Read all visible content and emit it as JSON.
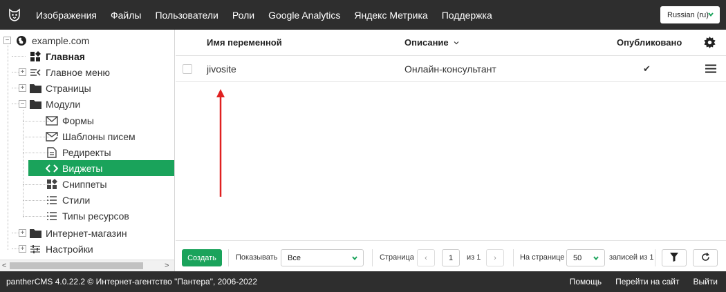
{
  "topbar": {
    "logo_icon": "panther-logo-icon",
    "nav": [
      "Изображения",
      "Файлы",
      "Пользователи",
      "Роли",
      "Google Analytics",
      "Яндекс Метрика",
      "Поддержка"
    ],
    "language": "Russian (ru)"
  },
  "sidebar": {
    "root": "example.com",
    "items": [
      {
        "label": "Главная",
        "icon": "dashboard-icon"
      },
      {
        "label": "Главное меню",
        "icon": "menu-icon"
      },
      {
        "label": "Страницы",
        "icon": "folder-icon"
      },
      {
        "label": "Модули",
        "icon": "folder-icon"
      },
      {
        "label": "Формы",
        "icon": "mail-icon"
      },
      {
        "label": "Шаблоны писем",
        "icon": "mail-edit-icon"
      },
      {
        "label": "Редиректы",
        "icon": "document-icon"
      },
      {
        "label": "Виджеты",
        "icon": "code-icon"
      },
      {
        "label": "Сниппеты",
        "icon": "dashboard-icon"
      },
      {
        "label": "Стили",
        "icon": "list-icon"
      },
      {
        "label": "Типы ресурсов",
        "icon": "list-icon"
      },
      {
        "label": "Интернет-магазин",
        "icon": "folder-icon"
      },
      {
        "label": "Настройки",
        "icon": "sliders-icon"
      }
    ]
  },
  "table": {
    "columns": {
      "name": "Имя переменной",
      "description": "Описание",
      "published": "Опубликовано"
    },
    "rows": [
      {
        "name": "jivosite",
        "description": "Онлайн-консультант",
        "published": "✔"
      }
    ]
  },
  "toolbar": {
    "create": "Создать",
    "show_label": "Показывать",
    "show_value": "Все",
    "page_label": "Страница",
    "page_value": "1",
    "page_of": "из 1",
    "prev": "‹",
    "next": "›",
    "per_page_label": "На странице",
    "per_page_value": "50",
    "records": "записей из 1"
  },
  "footer": {
    "copyright": "pantherCMS 4.0.22.2 © Интернет-агентство \"Пантера\", 2006-2022",
    "links": [
      "Помощь",
      "Перейти на сайт",
      "Выйти"
    ]
  },
  "colors": {
    "accent": "#1aa35b",
    "dark": "#2e2e2e",
    "annotation": "#e02020"
  }
}
